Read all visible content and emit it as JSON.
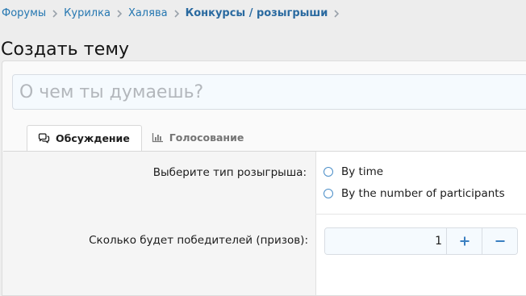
{
  "breadcrumb": {
    "items": [
      "Форумы",
      "Курилка",
      "Халява",
      "Конкурсы / розыгрыши"
    ]
  },
  "page": {
    "title": "Создать тему"
  },
  "title_input": {
    "placeholder": "О чем ты думаешь?",
    "value": ""
  },
  "tabs": [
    {
      "label": "Обсуждение",
      "icon": "comments-icon",
      "active": true
    },
    {
      "label": "Голосование",
      "icon": "bar-chart-icon",
      "active": false
    }
  ],
  "form": {
    "giveaway_type": {
      "label": "Выберите тип розыгрыша:",
      "options": [
        "By time",
        "By the number of participants"
      ]
    },
    "winners": {
      "label": "Сколько будет победителей (призов):",
      "value": "1",
      "increment_icon": "plus-icon",
      "decrement_icon": "minus-icon"
    }
  },
  "colors": {
    "link": "#2577b1",
    "accent": "#4b8ec8",
    "page_bg": "#ededed",
    "input_bg": "#f5fafe"
  }
}
